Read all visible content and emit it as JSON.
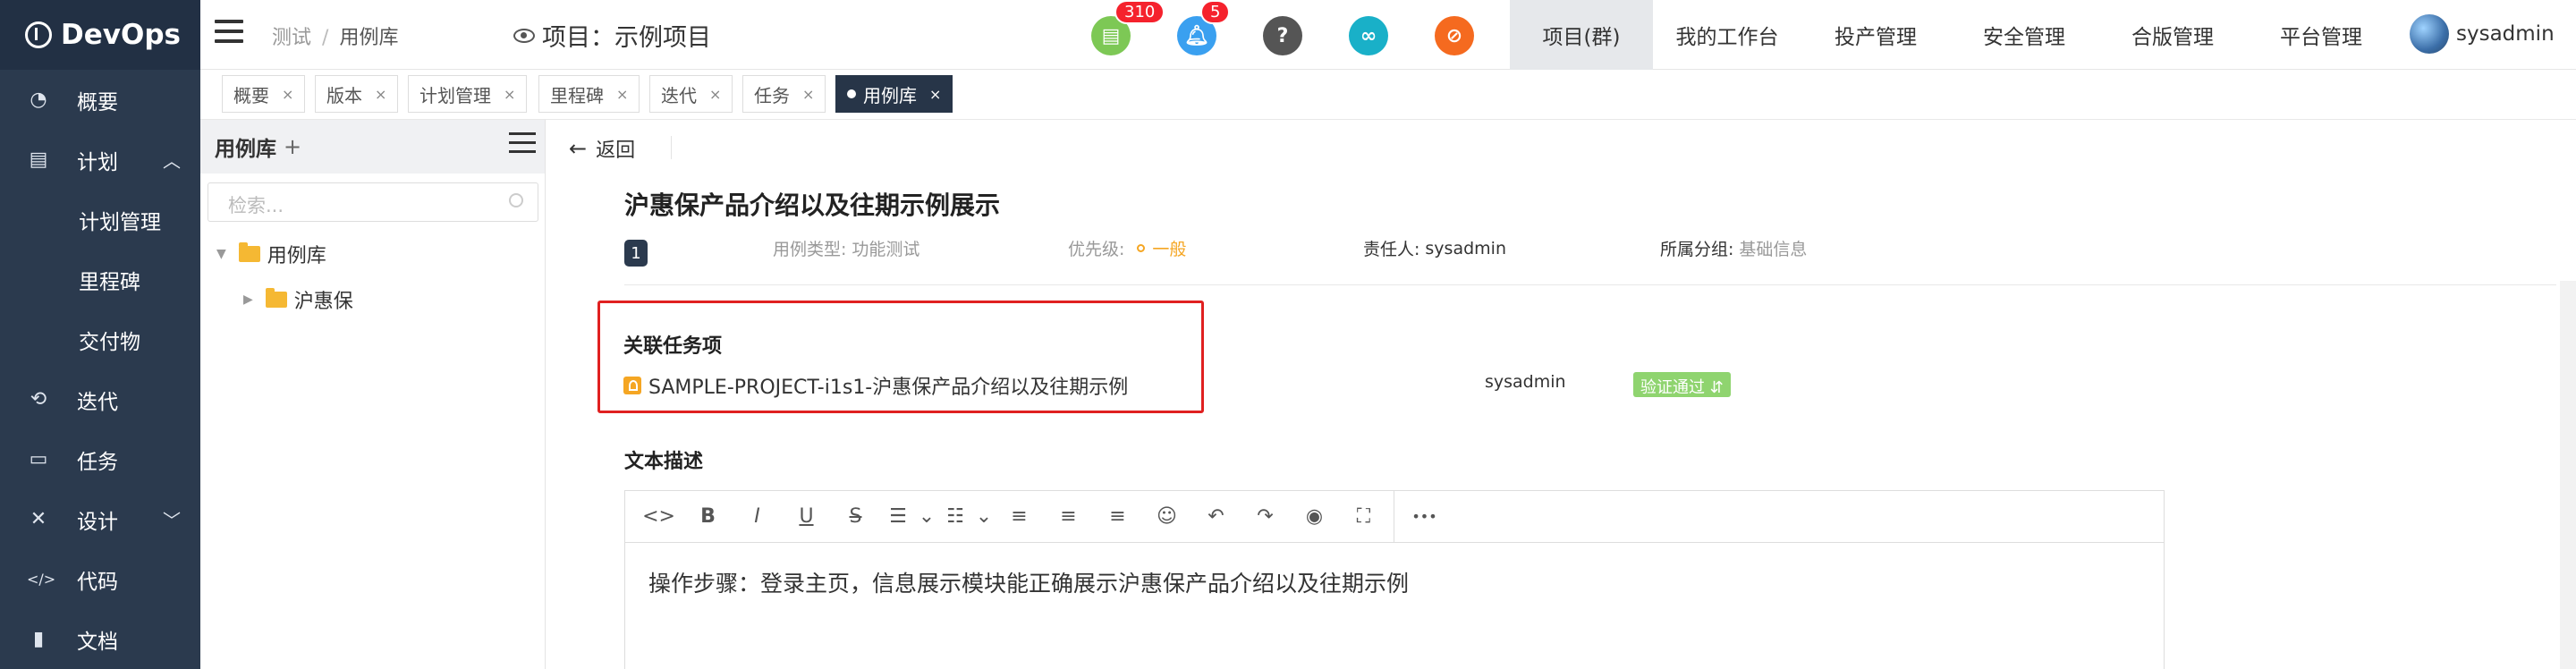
{
  "sidebar": {
    "logo": "DevOps",
    "items": [
      {
        "label": "概要",
        "icon": "dashboard-icon"
      },
      {
        "label": "计划",
        "icon": "plan-icon",
        "expanded": true
      },
      {
        "label": "计划管理"
      },
      {
        "label": "里程碑"
      },
      {
        "label": "交付物"
      },
      {
        "label": "迭代",
        "icon": "iteration-icon"
      },
      {
        "label": "任务",
        "icon": "task-icon"
      },
      {
        "label": "设计",
        "icon": "design-icon",
        "expanded": false
      },
      {
        "label": "代码",
        "icon": "code-icon"
      },
      {
        "label": "文档",
        "icon": "document-icon"
      }
    ]
  },
  "header": {
    "breadcrumb": [
      "测试",
      "用例库"
    ],
    "project": "项目：示例项目",
    "icons": [
      {
        "name": "document-icon",
        "badge": "310",
        "color": "#7dc855"
      },
      {
        "name": "bell-icon",
        "badge": "5",
        "color": "#3aa0f0"
      },
      {
        "name": "help-icon",
        "color": "#555555"
      },
      {
        "name": "link-icon",
        "color": "#19b0c8"
      },
      {
        "name": "compass-icon",
        "color": "#f56a1f"
      }
    ],
    "nav": [
      "项目(群)",
      "我的工作台",
      "投产管理",
      "安全管理",
      "合版管理",
      "平台管理"
    ],
    "user": "sysadmin"
  },
  "tabs": [
    {
      "label": "概要"
    },
    {
      "label": "版本"
    },
    {
      "label": "计划管理"
    },
    {
      "label": "里程碑"
    },
    {
      "label": "迭代"
    },
    {
      "label": "任务"
    },
    {
      "label": "用例库",
      "active": true
    }
  ],
  "tree": {
    "title": "用例库",
    "add": "+",
    "search_placeholder": "检索...",
    "root": "用例库",
    "child": "沪惠保"
  },
  "main": {
    "back": "返回",
    "title": "沪惠保产品介绍以及往期示例展示",
    "number": "1",
    "type_label": "用例类型:",
    "type_value": "功能测试",
    "priority_label": "优先级:",
    "priority_value": "一般",
    "owner_label": "责任人:",
    "owner_value": "sysadmin",
    "group_label": "所属分组:",
    "group_value": "基础信息",
    "related_title": "关联任务项",
    "related_task": "SAMPLE-PROJECT-i1s1-沪惠保产品介绍以及往期示例",
    "related_assignee": "sysadmin",
    "related_status": "验证通过 ⇵",
    "desc_title": "文本描述",
    "desc_text": "操作步骤：登录主页，信息展示模块能正确展示沪惠保产品介绍以及往期示例"
  },
  "toolbar": [
    {
      "name": "code-icon",
      "glyph": "<>"
    },
    {
      "name": "bold-icon",
      "glyph": "B"
    },
    {
      "name": "italic-icon",
      "glyph": "I"
    },
    {
      "name": "underline-icon",
      "glyph": "U"
    },
    {
      "name": "strikethrough-icon",
      "glyph": "S"
    },
    {
      "name": "bullet-list-icon",
      "glyph": "☰"
    },
    {
      "name": "chevron-down-icon",
      "glyph": "⌄"
    },
    {
      "name": "numbered-list-icon",
      "glyph": "☷"
    },
    {
      "name": "chevron-down-icon",
      "glyph": "⌄"
    },
    {
      "name": "align-left-icon",
      "glyph": "≡"
    },
    {
      "name": "align-center-icon",
      "glyph": "≡"
    },
    {
      "name": "align-right-icon",
      "glyph": "≡"
    },
    {
      "name": "emoji-icon",
      "glyph": "☺"
    },
    {
      "name": "undo-icon",
      "glyph": "↶"
    },
    {
      "name": "redo-icon",
      "glyph": "↷"
    },
    {
      "name": "preview-icon",
      "glyph": "◉"
    },
    {
      "name": "fullscreen-icon",
      "glyph": "⛶"
    },
    {
      "name": "more-icon",
      "glyph": "•••"
    }
  ]
}
